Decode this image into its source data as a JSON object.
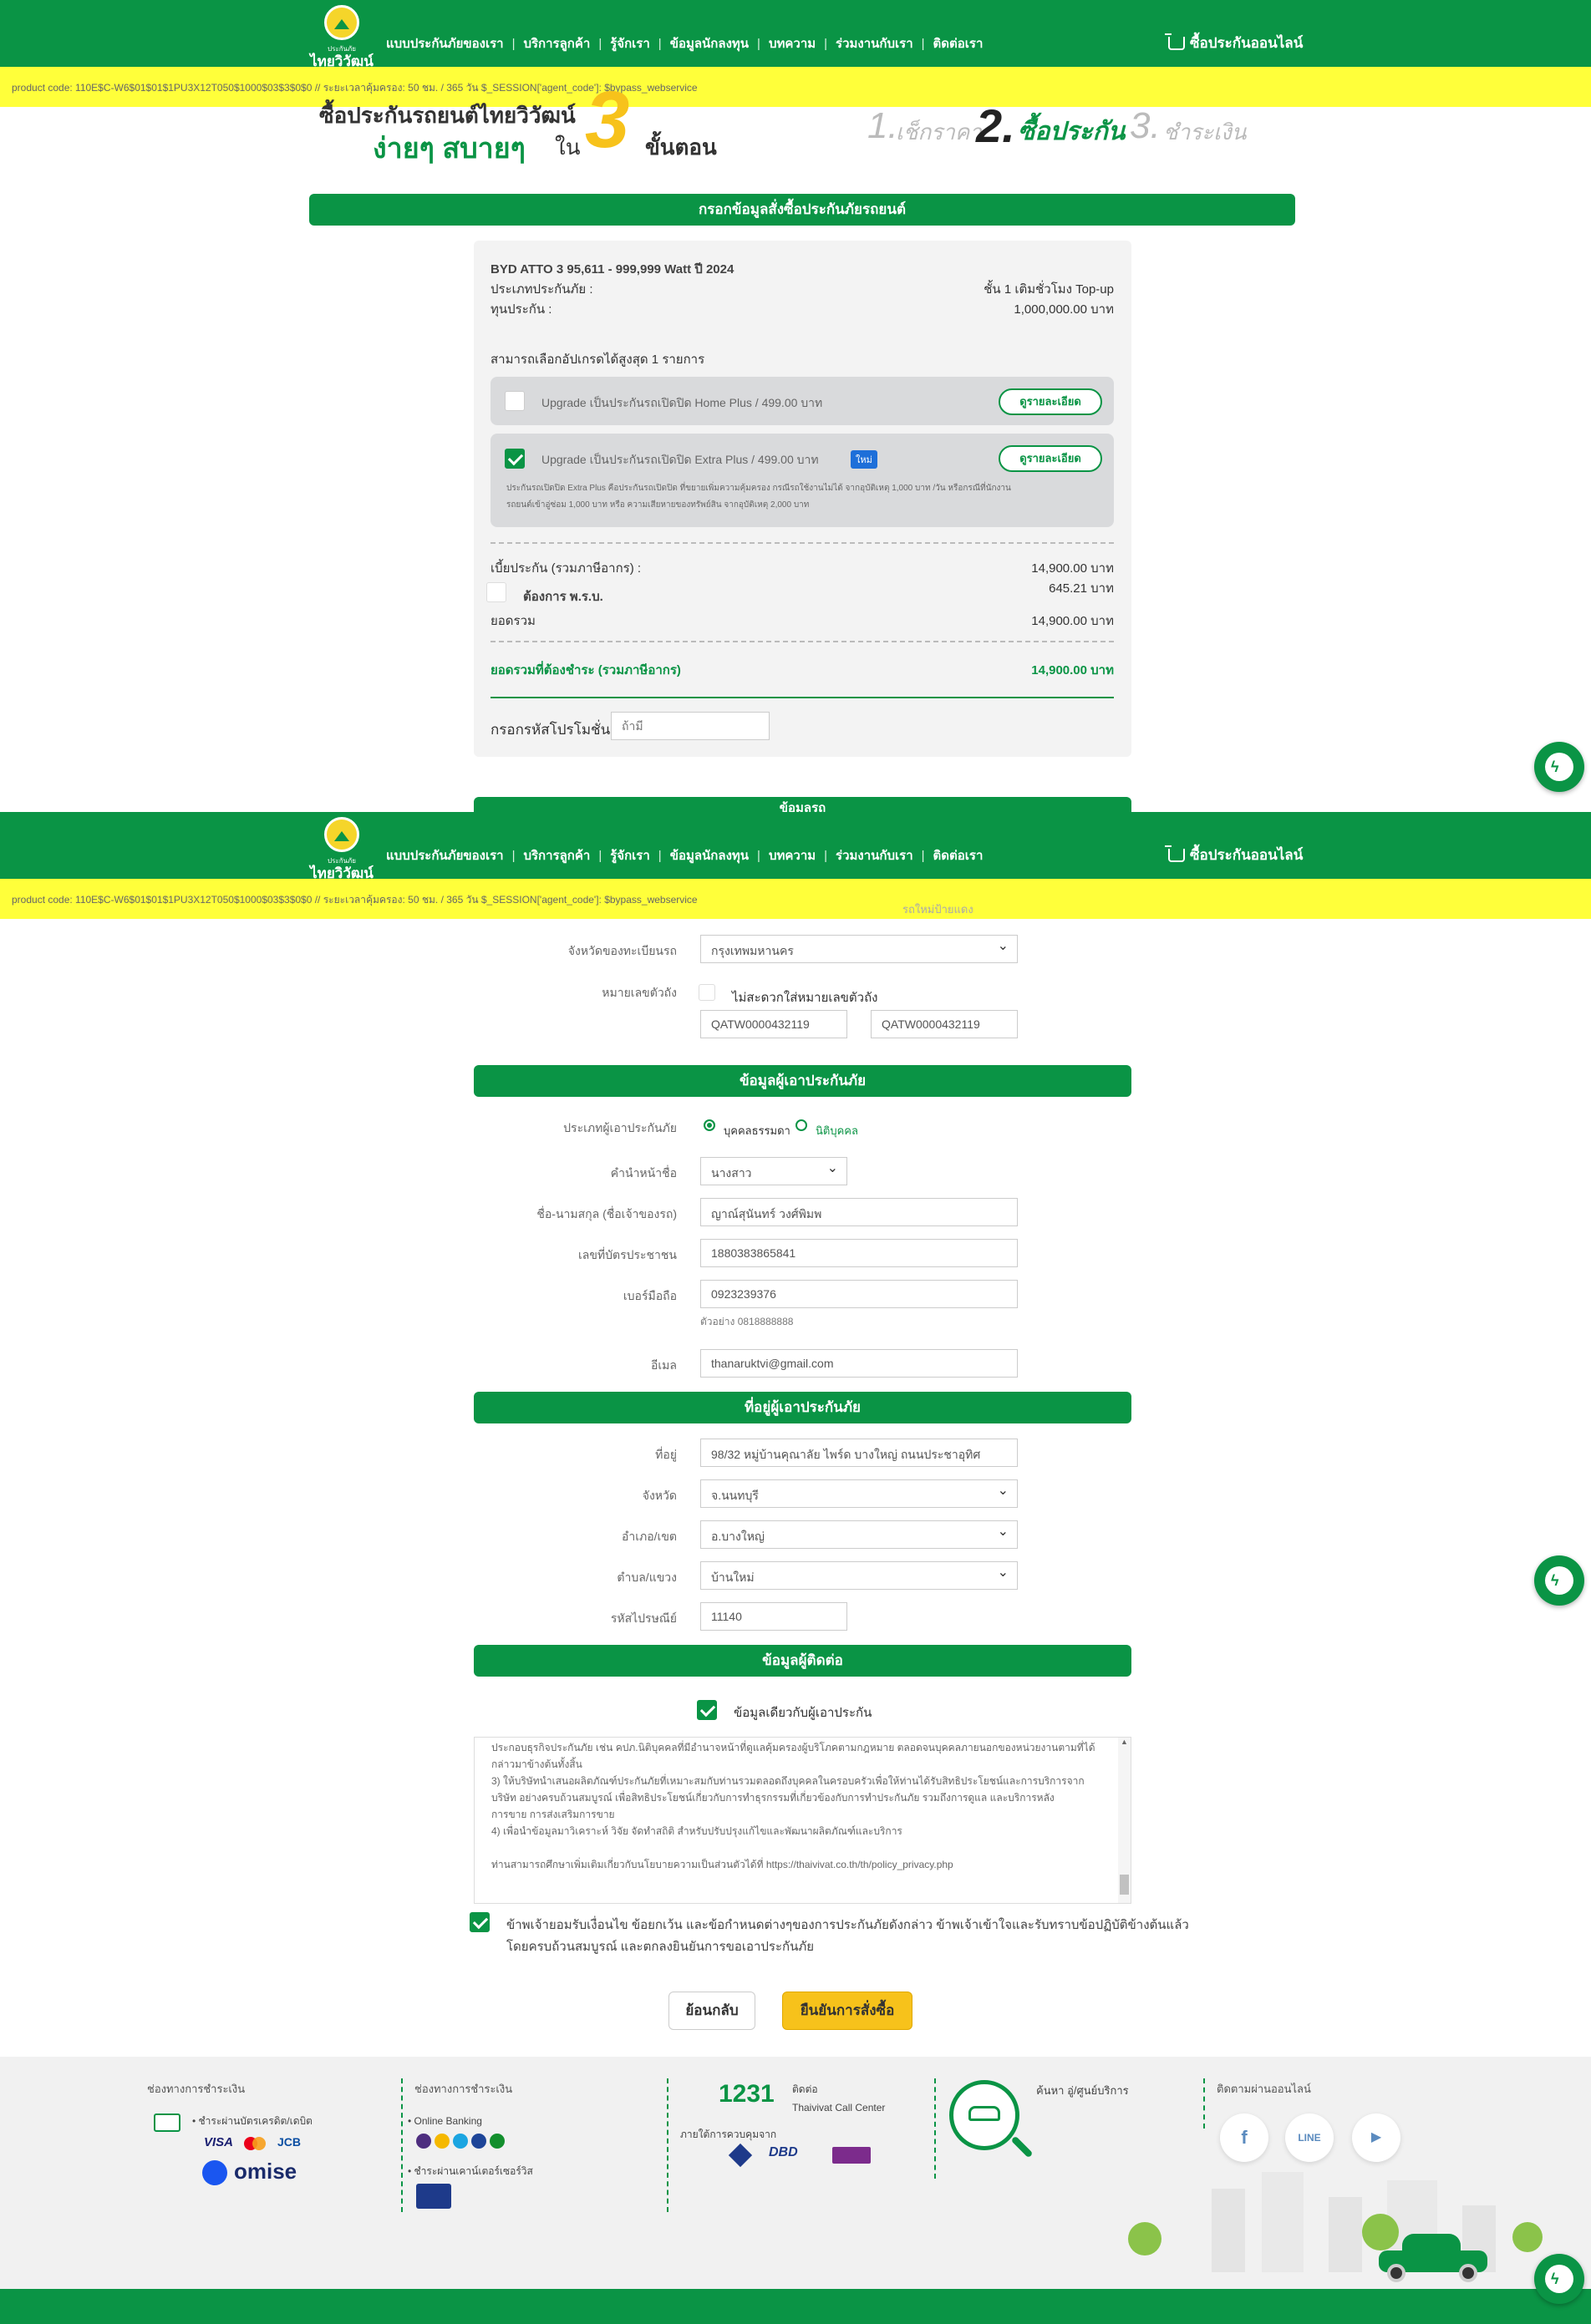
{
  "header": {
    "logo_small": "ประกันภัย",
    "logo_big": "ไทยวิวัฒน์",
    "nav": [
      "แบบประกันภัยของเรา",
      "บริการลูกค้า",
      "รู้จักเรา",
      "ข้อมูลนักลงทุน",
      "บทความ",
      "ร่วมงานกับเรา",
      "ติดต่อเรา"
    ],
    "buy_online": "ซื้อประกันออนไลน์"
  },
  "debug_bar": "product code: 110E$C-W6$01$01$1PU3X12T050$1000$03$3$0$0 // ระยะเวลาคุ้มครอง: 50 ชม. / 365 วัน $_SESSION['agent_code']: $bypass_webservice",
  "hero": {
    "line1": "ซื้อประกันรถยนต์ไทยวิวัฒน์",
    "easy": "ง่ายๆ สบายๆ",
    "in": "ใน",
    "num": "3",
    "steps_word": "ขั้นตอน",
    "step1_num": "1.",
    "step1": "เช็กราคา",
    "step2_num": "2.",
    "step2": "ซื้อประกัน",
    "step3_num": "3.",
    "step3": "ชำระเงิน"
  },
  "order_section_title": "กรอกข้อมูลสั่งซื้อประกันภัยรถยนต์",
  "order": {
    "car": "BYD ATTO 3 95,611 - 999,999 Watt ปี 2024",
    "type_label": "ประเภทประกันภัย :",
    "type_value": "ชั้น 1 เติมชั่วโมง Top-up",
    "sum_label": "ทุนประกัน :",
    "sum_value": "1,000,000.00 บาท",
    "upgrade_note": "สามารถเลือกอัปเกรดได้สูงสุด 1 รายการ",
    "upgrade1": "Upgrade เป็นประกันรถเปิดปิด Home Plus / 499.00 บาท",
    "upgrade1_btn": "ดูรายละเอียด",
    "upgrade2": "Upgrade เป็นประกันรถเปิดปิด Extra Plus / 499.00 บาท",
    "upgrade2_badge": "ใหม่",
    "upgrade2_btn": "ดูรายละเอียด",
    "upgrade2_desc1": "ประกันรถเปิดปิด Extra Plus คือประกันรถเปิดปิด ที่ขยายเพิ่มความคุ้มครอง กรณีรถใช้งานไม่ได้ จากอุบัติเหตุ 1,000 บาท /วัน หรือกรณีที่นักงาน",
    "upgrade2_desc2": "รถยนต์เข้าอู่ซ่อม 1,000 บาท หรือ ความเสียหายของทรัพย์สิน จากอุบัติเหตุ 2,000 บาท",
    "premium_label": "เบี้ยประกัน (รวมภาษีอากร) :",
    "premium_value": "14,900.00 บาท",
    "prb_label": "ต้องการ พ.ร.บ.",
    "prb_value": "645.21 บาท",
    "total_label": "ยอดรวม",
    "total_value": "14,900.00 บาท",
    "pay_label": "ยอดรวมที่ต้องชำระ (รวมภาษีอากร)",
    "pay_value": "14,900.00 บาท",
    "promo_label": "กรอกรหัสโปรโมชั่น",
    "promo_placeholder": "ถ้ามี"
  },
  "cut_title": "ข้อมูลรถ",
  "car_info": {
    "overlap_text": "รถใหม่ป้ายแดง",
    "province_label": "จังหวัดของทะเบียนรถ",
    "province_value": "กรุงเทพมหานคร",
    "chassis_label": "หมายเลขตัวถัง",
    "no_chassis": "ไม่สะดวกใส่หมายเลขตัวถัง",
    "chassis1": "QATW0000432119",
    "chassis2": "QATW0000432119"
  },
  "insured_title": "ข้อมูลผู้เอาประกันภัย",
  "insured": {
    "type_label": "ประเภทผู้เอาประกันภัย",
    "type_person": "บุคคลธรรมดา",
    "type_corp": "นิติบุคคล",
    "prefix_label": "คำนำหน้าชื่อ",
    "prefix_value": "นางสาว",
    "name_label": "ชื่อ-นามสกุล (ชื่อเจ้าของรถ)",
    "name_value": "ญาณ์สุนันทร์ วงศ์พิมพ",
    "id_label": "เลขที่บัตรประชาชน",
    "id_value": "1880383865841",
    "mobile_label": "เบอร์มือถือ",
    "mobile_value": "0923239376",
    "mobile_hint": "ตัวอย่าง 0818888888",
    "email_label": "อีเมล",
    "email_value": "thanaruktvi@gmail.com"
  },
  "address_title": "ที่อยู่ผู้เอาประกันภัย",
  "address": {
    "addr_label": "ที่อยู่",
    "addr_value": "98/32 หมู่บ้านคุณาลัย ไพร์ด บางใหญ่ ถนนประชาอุทิศ",
    "province_label": "จังหวัด",
    "province_value": "จ.นนทบุรี",
    "district_label": "อำเภอ/เขต",
    "district_value": "อ.บางใหญ่",
    "subdistrict_label": "ตำบล/แขวง",
    "subdistrict_value": "บ้านใหม่",
    "zip_label": "รหัสไปรษณีย์",
    "zip_value": "11140"
  },
  "contact_title": "ข้อมูลผู้ติดต่อ",
  "contact": {
    "same_as_insured": "ข้อมูลเดียวกับผู้เอาประกัน"
  },
  "privacy_lines": [
    "ประกอบธุรกิจประกันภัย เช่น คปภ.นิติบุคคลที่มีอำนาจหน้าที่ดูแลคุ้มครองผู้บริโภคตามกฎหมาย ตลอดจนบุคคลภายนอกของหน่วยงานตามที่ได้",
    "กล่าวมาข้างต้นทั้งสิ้น",
    "3) ให้บริษัทนำเสนอผลิตภัณฑ์ประกันภัยที่เหมาะสมกับท่านรวมตลอดถึงบุคคลในครอบครัวเพื่อให้ท่านได้รับสิทธิประโยชน์และการบริการจาก",
    "บริษัท อย่างครบถ้วนสมบูรณ์ เพื่อสิทธิประโยชน์เกี่ยวกับการทำธุรกรรมที่เกี่ยวข้องกับการทำประกันภัย รวมถึงการดูแล และบริการหลัง",
    "การขาย การส่งเสริมการขาย",
    "4) เพื่อนำข้อมูลมาวิเคราะห์ วิจัย จัดทำสถิติ สำหรับปรับปรุงแก้ไขและพัฒนาผลิตภัณฑ์และบริการ",
    "",
    "ท่านสามารถศึกษาเพิ่มเติมเกี่ยวกับนโยบายความเป็นส่วนตัวได้ที่ https://thaivivat.co.th/th/policy_privacy.php"
  ],
  "consent": {
    "line1": "ข้าพเจ้ายอมรับเงื่อนไข ข้อยกเว้น และข้อกำหนดต่างๆของการประกันภัยดังกล่าว ข้าพเจ้าเข้าใจและรับทราบข้อปฏิบัติข้างต้นแล้ว",
    "line2": "โดยครบถ้วนสมบูรณ์ และตกลงยินยันการขอเอาประกันภัย"
  },
  "buttons": {
    "back": "ย้อนกลับ",
    "confirm": "ยืนยันการสั่งซื้อ"
  },
  "footer": {
    "col1_title": "ช่องทางการชำระเงิน",
    "col1_item": "• ชำระผ่านบัตรเครดิต/เดบิต",
    "omise": "omise",
    "col2_title": "ช่องทางการชำระเงิน",
    "col2_item1": "• Online Banking",
    "col2_item2": "• ชำระผ่านเคาน์เตอร์เซอร์วิส",
    "call_number": "1231",
    "call_label": "ติดต่อ",
    "call_center": "Thaivivat Call Center",
    "regulated": "ภายใต้การควบคุมจาก",
    "find_label": "ค้นหา อู่/ศูนย์บริการ",
    "social_title": "ติดตามผ่านออนไลน์",
    "social_line": "LINE"
  },
  "colors": {
    "brand_green": "#0a9445",
    "debug_yellow": "#ffff3a",
    "confirm_yellow": "#f7c21b"
  }
}
